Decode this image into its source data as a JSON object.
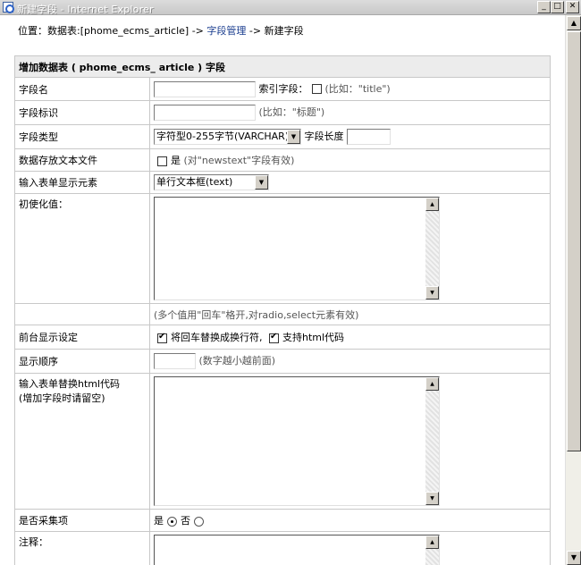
{
  "window": {
    "title": "新建字段 - Internet Explorer",
    "min_glyph": "_",
    "max_glyph": "□",
    "close_glyph": "✕"
  },
  "location": {
    "prefix": "位置：数据表:[phome_ecms_article] -> ",
    "link": "字段管理",
    "suffix": " -> 新建字段"
  },
  "form": {
    "header": "增加数据表 ( phome_ecms_ article ) 字段",
    "field_name": {
      "label": "字段名",
      "value": "",
      "index_label": "索引字段：",
      "hint": "(比如：\"title\")"
    },
    "field_ident": {
      "label": "字段标识",
      "value": "",
      "hint": "(比如：\"标题\")"
    },
    "field_type": {
      "label": "字段类型",
      "selected": "字符型0-255字节(VARCHAR)",
      "length_label": "字段长度",
      "length_value": ""
    },
    "store_file": {
      "label": "数据存放文本文件",
      "option": "是",
      "hint": "(对\"newstext\"字段有效)"
    },
    "input_element": {
      "label": "输入表单显示元素",
      "selected": "单行文本框(text)"
    },
    "init_value": {
      "label": "初使化值：",
      "value": "",
      "hint": "(多个值用\"回车\"格开,对radio,select元素有效)"
    },
    "frontend": {
      "label": "前台显示设定",
      "opt1": "将回车替换成换行符,",
      "opt2": "支持html代码"
    },
    "order": {
      "label": "显示顺序",
      "value": "",
      "hint": "(数字越小越前面)"
    },
    "html_replace": {
      "label_line1": "输入表单替换html代码",
      "label_line2": "(增加字段时请留空)",
      "value": ""
    },
    "collect": {
      "label": "是否采集项",
      "yes": "是",
      "no": "否",
      "selected": "yes"
    },
    "note": {
      "label": "注释：",
      "value": ""
    }
  }
}
